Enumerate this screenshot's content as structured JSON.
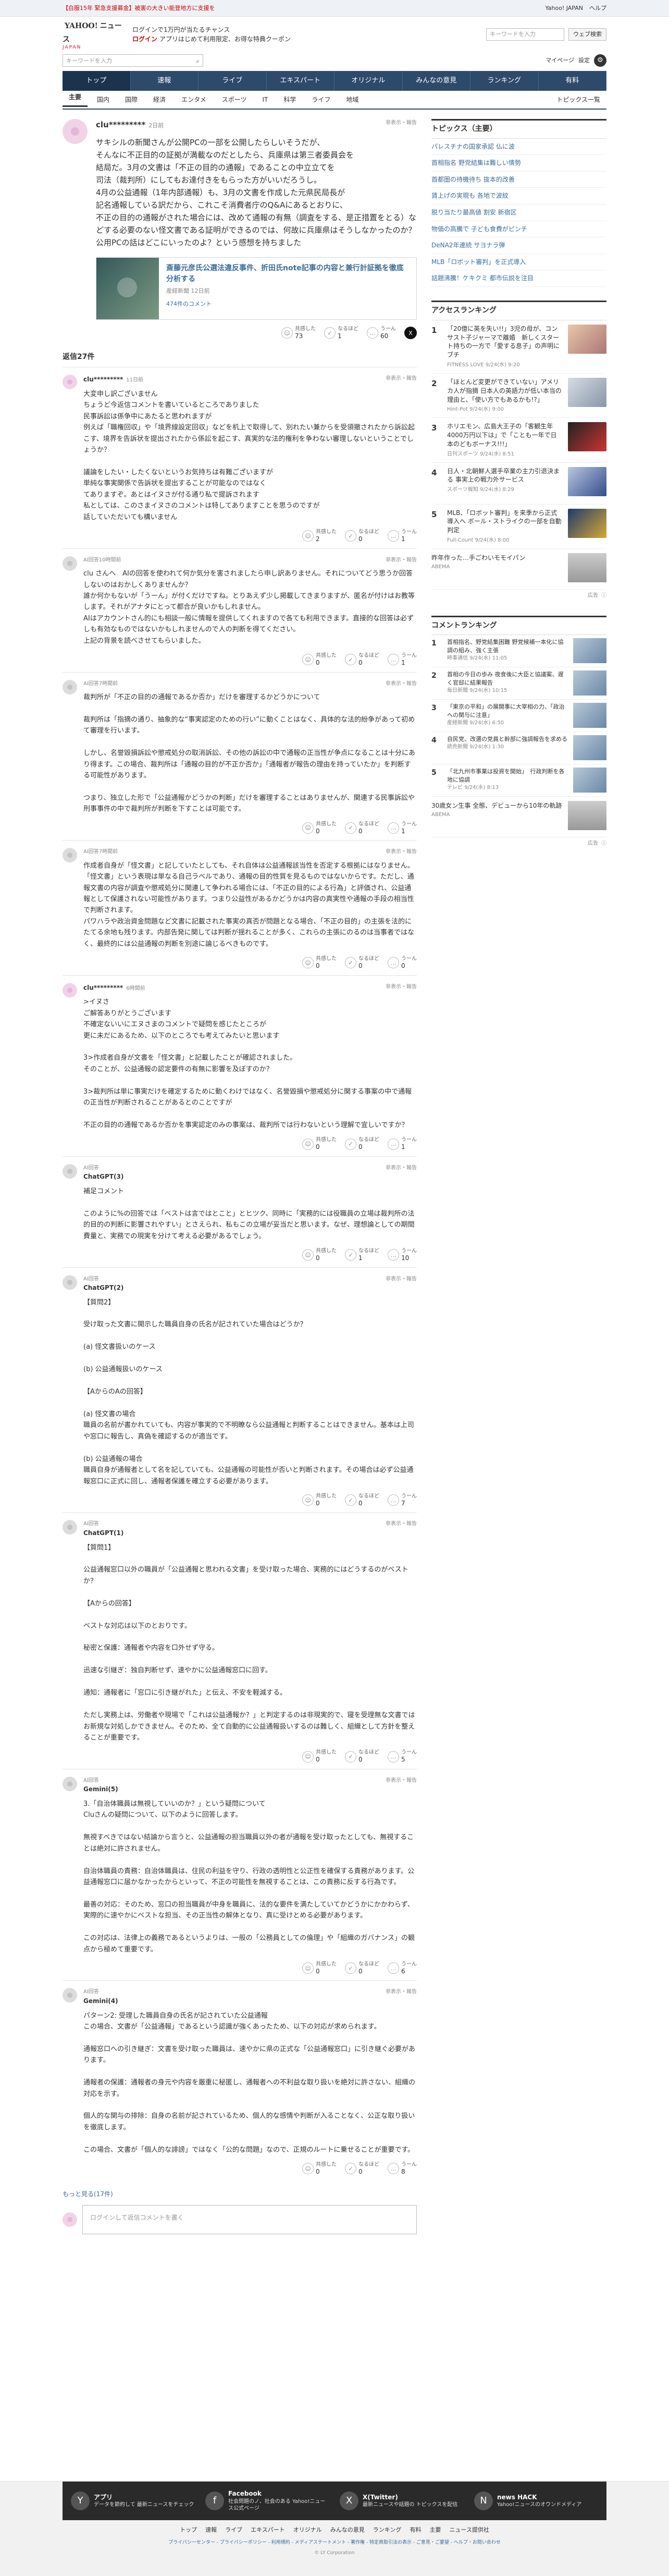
{
  "topbar": {
    "alert": "【白服15年 緊急支援募金】被害の大きい能登地方に支援を",
    "link": "Yahoo! JAPAN",
    "help": "ヘルプ"
  },
  "header": {
    "logo": "YAHOO!",
    "logo_sub": "ニュース",
    "logo_tag": "JAPAN",
    "msg1": "ログインで1万円が当たるチャンス",
    "login": "ログイン",
    "msg2": "アプリはじめて利用限定、お得な特典クーポン",
    "search_placeholder": "キーワードを入力",
    "search_button": "ウェブ検索"
  },
  "nav2": {
    "search_placeholder": "キーワードを入力",
    "mypage": "マイページ",
    "settings": "設定"
  },
  "gnav": [
    "トップ",
    "速報",
    "ライブ",
    "エキスパート",
    "オリジナル",
    "みんなの意見",
    "ランキング",
    "有料"
  ],
  "snav": {
    "items": [
      "主要",
      "国内",
      "国際",
      "経済",
      "エンタメ",
      "スポーツ",
      "IT",
      "科学",
      "ライフ",
      "地域"
    ],
    "more": "トピックス一覧"
  },
  "article": {
    "user": "clu*********",
    "time": "2日前",
    "report": "非表示・報告",
    "text": [
      "サキシルの新聞さんが公開PCの一部を公開したらしいそうだが、",
      "そんなに不正目的の証拠が満載なのだとしたら、兵庫県は第三者委員会を",
      "結局だ。3月の文書は「不正の目的の通報」であることの中立立てを",
      "司法（裁判所）にしてもお達付きをもらった方がいいだろうし。",
      "4月の公益通報（1年内部通報）も、3月の文書を作成した元県民局長が",
      "記名通報している訳だから、これこそ消費者庁のQ&Aにあるとおりに、",
      "不正の目的の通報がされた場合には、改めて通報の有無（調査をする、是正措置をとる）などする必要のない怪文書である証明ができるのでは、何故に兵庫県はそうしなかったのか？",
      "公用PCの話はどこにいったのよ？という感想を持ちました"
    ],
    "link_title": "斎藤元彦氏公選法違反事件、折田氏note記事の内容と兼行計証拠を徹底分析する",
    "link_source": "産経新聞",
    "link_time": "12日前",
    "link_comments": "474件のコメント",
    "acts": {
      "agree_label": "共感した",
      "agree": "73",
      "insight_label": "なるほど",
      "insight": "1",
      "neg_label": "うーん",
      "neg": "60"
    }
  },
  "replies_title": "返信27件",
  "replies": [
    {
      "user": "clu*********",
      "time": "11日前",
      "ai": false,
      "text": "大変申し訳ございません\nちょうど今返信コメントを書いているところでありました\n民事訴訟は係争中にあたると思われますが\n例えば「職権回収」や「境界線設定回収」などを机上で取得して、別れたい兼からを受領撤されたから訴訟起こす、境界を告訴状を提出されたから係訟を起こす、真実的な法的権利を争わない審理しないということでしょうか？\n\n議論をしたい・したくないというお気持ちは有難ございますが\n単純な事実関係で告訴状を提出することが可能なのではなく\nてありますぞ。あとはイヌさが付る通り私で提訴されます\n私としては、このさまイヌさのコメントは特してありますことを思うのですが\n話していただいても構いません",
      "agree": "2",
      "insight": "0",
      "neg": "1"
    },
    {
      "user": "AI回答",
      "time": "10時間前",
      "ai": true,
      "text": "clu さんへ　AIの回答を使われて何か気分を害されましたら申し訳ありません。それについてどう思うか回答しないのはおかしくありませんか？\n誰か何かもないが「うーん」が付くだけですね。とりあえず少し掲載してきまりますが、匿名が付けはお教等します。それがアナタにとって都合が良いかもしれません。\nAIはアカウントさん的にも相談一般に情報を提供してくれますので各ても利用できます。直接的な回答は必ずしも有効なものではないかもしれませんので人の判断を得てください。\n上記の背景を読べさせてもらいました。",
      "agree": "0",
      "insight": "0",
      "neg": "1"
    },
    {
      "user": "AI回答",
      "time": "7時間前",
      "ai": true,
      "text": "裁判所が「不正の目的の通報であるか否か」だけを審理するかどうかについて\n\n裁判所は「指摘の通り、抽象的な“事実認定のための行い”に動くことはなく、具体的な法的紛争があって初めて審理を行います。\n\nしかし、名誉毀損訴訟や懲戒処分の取消訴訟、その他の訴訟の中で通報の正当性が争点になることは十分にあり得ます。この場合、裁判所は「通報の目的が不正か否か」「通報者が報告の理由を持っていたか」を判断する可能性があります。\n\nつまり、独立した形で「公益通報かどうかの判断」だけを審理することはありませんが、関連する民事訴訟や刑事事件の中で裁判所が判断を下すことは可能です。",
      "agree": "0",
      "insight": "0",
      "neg": "1"
    },
    {
      "user": "AI回答",
      "time": "7時間前",
      "ai": true,
      "text": "作成者自身が「怪文書」と記していたとしても、それ自体は公益通報該当性を否定する根拠にはなりません。「怪文書」という表現は単なる自己ラベルであり、通報の目的性質を見るものではないからです。ただし、通報文書の内容が調査や懲戒処分に関連して争われる場合には、「不正の目的による行為」と評価され、公益通報として保護されない可能性があります。つまり公益性があるかどうかは内容の真実性や通報の手段の相当性で判断されます。\nパワハラや政治資金問題など文書に記載された事実の真否が問題となる場合、「不正の目的」の主張を法的にたてる余地も残ります。内部告発に関しては判断が揺れることが多く、これらの主張にのるのは当事者ではなく、最終的には公益通報の判断を別途に論じるべきものです。",
      "agree": "0",
      "insight": "0",
      "neg": "0"
    },
    {
      "user": "clu*********",
      "time": "6時間前",
      "ai": false,
      "text": ">イヌさ\nご解答ありがとうございます\n不確定ないいにエヌさまのコメントで疑問を感じたところが\n更に未だにあるため、以下のところでも考えてみたいと思います\n\n3>作成者自身が文書を「怪文書」と記載したことが確認されました。\nそのことが、公益通報の認定要件の有無に影響を及ぼすのか？\n\n3>裁判所は単に事実だけを確定するために動くわけではなく、名誉毀損や懲戒処分に関する事案の中で通報の正当性が判断されることがあるとのことですが\n\n不正の目的の通報であるか否かを事実認定のみの事案は、裁判所では行わないという理解で宜しいですか？",
      "agree": "0",
      "insight": "0",
      "neg": "1"
    },
    {
      "user": "AI回答",
      "time": "",
      "ai": true,
      "label": "ChatGPT(3)",
      "text": "補足コメント\n\nこのように%の回答では「ベストは言ではとこと」とヒツク、同時に「実務的には役職員の立場は裁判所の法的目的の判断に影響されやすい」とさえられ、私もこの立場が妥当だと思います。なぜ、理想論としての期間費量と、実務での現実を分けて考える必要があるでしょう。",
      "agree": "0",
      "insight": "1",
      "neg": "10"
    },
    {
      "user": "AI回答",
      "time": "",
      "ai": true,
      "label": "ChatGPT(2)",
      "text": "【質問2】\n\n受け取った文書に開示した職員自身の氏名が記されていた場合はどうか？\n\n(a) 怪文書扱いのケース\n\n(b) 公益通報扱いのケース\n\n【AからのAの回答】\n\n(a) 怪文書の場合\n職員の名前が書かれていても、内容が事実的で不明瞭なら公益通報と判断することはできません。基本は上司や窓口に報告し、真偽を確認するのが適当です。\n\n(b) 公益通報の場合\n職員自身が通報者として名を記していても、公益通報の可能性が否いと判断されます。その場合は必ず公益通報窓口に正式に回し、通報者保護を確立する必要があります。",
      "agree": "0",
      "insight": "0",
      "neg": "7"
    },
    {
      "user": "AI回答",
      "time": "",
      "ai": true,
      "label": "ChatGPT(1)",
      "text": "【質問1】\n\n公益通報窓口以外の職員が「公益通報と思われる文書」を受け取った場合、実務的にはどうするのがベストか？\n\n【Aからの回答】\n\nベストな対応は以下のとおりです。\n\n秘密と保護：通報者や内容を口外せず守る。\n\n迅速な引継ぎ：独自判断せず、速やかに公益通報窓口に回す。\n\n通知：通報者に「窓口に引き継がれた」と伝え、不安を軽減する。\n\nただし実務上は、労働者や現場で「これは公益通報か？」と判定するのは非現実的で、寝を受理無な文書ではお新規な対処しかできません。そのため、全て自動的に公益通報扱いするのは難しく、組織として方針を整えることが重要です。",
      "agree": "0",
      "insight": "0",
      "neg": "5"
    },
    {
      "user": "AI回答",
      "time": "",
      "ai": true,
      "label": "Gemini(5)",
      "text": "3.「自治体職員は無視していいのか？」という疑問について\nCluさんの疑問について、以下のように回答します。\n\n無視すべきではない結論から言うと、公益通報の担当職員以外の者が通報を受け取ったとしても、無視することは絶対に許されません。\n\n自治体職員の責務：自治体職員は、住民の利益を守り、行政の透明性と公正性を確保する責務があります。公益通報窓口に届かなかったからといって、不正の可能性を無視することは、この責務に反する行為です。\n\n最善の対応：そのため、窓口の担当職員が中身を職員に、法的な要件を満たしていてかどうかにかかわらず、実際的に速やかにベストな担当、その正当性の解体となり、真に受けとめる必要があります。\n\nこの対応は、法律上の義務であるというよりは、一般の「公務員としての倫理」や「組織のガバナンス」の観点から極めて重要です。",
      "agree": "0",
      "insight": "0",
      "neg": "6"
    },
    {
      "user": "AI回答",
      "time": "",
      "ai": true,
      "label": "Gemini(4)",
      "text": "パターン2: 受理した職員自身の氏名が記されていた公益通報\nこの場合、文書が「公益通報」であるという認識が強くあったため、以下の対応が求められます。\n\n通報窓口への引き継ぎ：文書を受け取った職員は、速やかに県の正式な「公益通報窓口」に引き継ぐ必要があります。\n\n通報者の保護：通報者の身元や内容を厳重に秘匿し、通報者への不利益な取り扱いを絶対に許さない、組織の対応を示す。\n\n個人的な関与の排除：自身の名前が記されているため、個人的な感情や判断が入ることなく、公正な取り扱いを徹底します。\n\nこの場合、文書が「個人的な誹謗」ではなく「公的な問題」なので、正規のルートに乗せることが重要です。",
      "agree": "0",
      "insight": "0",
      "neg": "8"
    }
  ],
  "more": "もっと見る(17件)",
  "comment_placeholder": "ログインして返信コメントを書く",
  "side": {
    "topics_title": "トピックス（主要）",
    "topics": [
      "パレスチナの国家承認 仏に波",
      "首相指名 野党結集は難しい情勢",
      "首都圏の待機待ち 抜本的改善",
      "賃上げの実現も 各地で波紋",
      "脱り当たり最高値 割安 新宿区",
      "物価の高騰で 子ども食費がピンチ",
      "DeNA2年連続 サヨナラ弾",
      "MLB「ロボット審判」を正式導入",
      "話題沸騰！ケキクミ 都市伝説を注目"
    ],
    "access_title": "アクセスランキング",
    "access": [
      {
        "t": "「20億に英を失い!!」3児の母が、コンサスト子ジャーマで離婚　新しくスタート持ちの一方で「愛する息子」の声明にブチ",
        "m": "FITNESS LOVE 9/24(水) 9:20"
      },
      {
        "t": "「ほとんど変更ができていない」アメリカ人が指摘 日本人の英語力が低い本当の理由と、「使い方でもあるかも!?」",
        "m": "Hint-Pot 9/24(水) 9:00"
      },
      {
        "t": "ホリエモン、広島大王子の「客観生年4000万円以下は」で「ことも一年で日本のどもボーナス!!!」",
        "m": "日刊スポーツ 9/24(水) 8:51"
      },
      {
        "t": "日人・北朝鮮人選手卒業の主力引退決まる 事実上の戦力外サービス",
        "m": "スポーツ報知 9/24(水) 8:29"
      },
      {
        "t": "MLB、「ロボット審判」を来季から正式導入へ ボール・ストライクの一部を自動判定",
        "m": "Full-Count 9/24(水) 8:00"
      }
    ],
    "ad": {
      "t": "昨年作った…手ごわいモモイパン",
      "m": "ABEMA",
      "label": "広告"
    },
    "comments_title": "コメントランキング",
    "comments": [
      {
        "t": "首相指名、野党結集困難 野党候補一本化に協調の組み、強く主張",
        "m": "時事通信 9/24(水) 11:05"
      },
      {
        "t": "首相の今日の歩み 夜食後に大臣と協議案、遅く官邸に結果報告",
        "m": "毎日新聞 9/24(水) 10:15"
      },
      {
        "t": "「東京の平和」の展開事に大宰相の力、「政治への関与に注意」",
        "m": "産経新聞 9/24(水) 6:50"
      },
      {
        "t": "自民党、改選の党員と幹部に強調報告を求める",
        "m": "読売新聞 9/24(水) 1:30"
      },
      {
        "t": "「北九州市事業は投資を開始」　行政判断を各地に協調",
        "m": "テレビ 9/24(水) 8:13"
      }
    ],
    "ad2": {
      "t": "30歳女ン生事 全態、デビューから10年の軌跡",
      "m": "ABEMA",
      "label": "広告"
    }
  },
  "footer": {
    "items": [
      {
        "title": "アプリ",
        "text": "データを節約して 最新ニュースをチェック",
        "icon": "Y"
      },
      {
        "title": "Facebook",
        "text": "社会問題のノ、社会のある\nYahoo!ニュース公式ページ",
        "icon": "f"
      },
      {
        "title": "X(Twitter)",
        "text": "最新ニュースや話題の\nトピックスを配信",
        "icon": "X"
      },
      {
        "title": "news HACK",
        "text": "Yahoo!ニュースのオウンドメディア",
        "icon": "N"
      }
    ],
    "nav": [
      "トップ",
      "速報",
      "ライブ",
      "エキスパート",
      "オリジナル",
      "みんなの意見",
      "ランキング",
      "有料",
      "主要",
      "ニュース提供社"
    ],
    "links": "プライバシーセンター - プライバシーポリシー - 利用規約 - メディアステートメント - 著作権 - 特定商取引法の表示 - ご意見・ご要望 - ヘルプ・お問い合わせ",
    "copy": "© LY Corporation"
  }
}
